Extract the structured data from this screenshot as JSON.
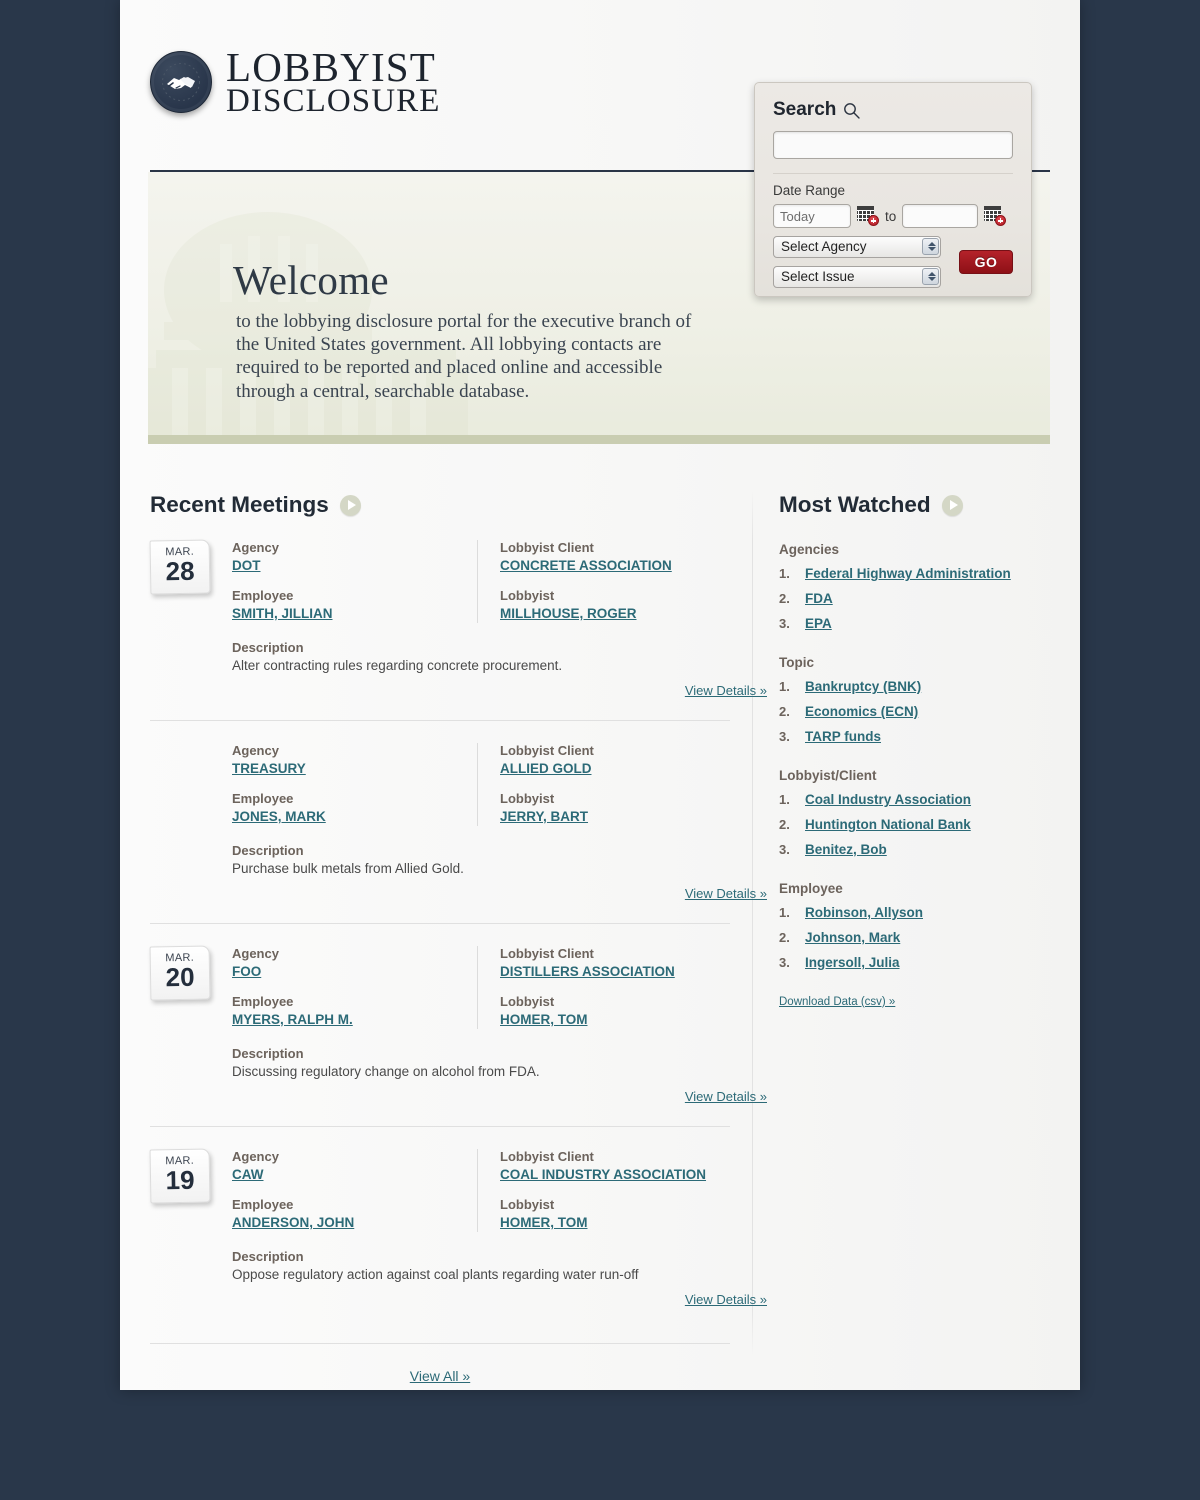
{
  "brand": {
    "line1": "LOBBYIST",
    "line2": "DISCLOSURE",
    "logo_icon": "handshake-icon"
  },
  "search": {
    "title": "Search",
    "search_icon": "search-icon",
    "query_value": "",
    "query_placeholder": "",
    "date_range_label": "Date Range",
    "date_from_value": "Today",
    "date_from_placeholder": "Today",
    "date_to_value": "",
    "date_to_placeholder": "",
    "to_label": "to",
    "calendar_icon": "calendar-add-icon",
    "agency_select": "Select Agency",
    "issue_select": "Select Issue",
    "go_label": "GO",
    "accent_red": "#9d1b22"
  },
  "banner": {
    "heading": "Welcome",
    "paragraph": "to the lobbying disclosure portal for the executive branch of the United States government. All lobbying contacts are required to be reported and placed online and accessible through a central, searchable database.",
    "watermark": "capitol-building-watermark",
    "foot_color": "#c9cdb1"
  },
  "recent_meetings": {
    "heading": "Recent Meetings",
    "arrow_icon": "play-arrow-icon",
    "labels": {
      "agency": "Agency",
      "employee": "Employee",
      "lobbyist_client": "Lobbyist Client",
      "lobbyist": "Lobbyist",
      "description": "Description",
      "view_details": "View Details »"
    },
    "view_all": "View All »",
    "items": [
      {
        "date_month": "MAR.",
        "date_day": "28",
        "has_date": true,
        "agency": "DOT",
        "employee": "SMITH, JILLIAN",
        "client": "CONCRETE ASSOCIATION",
        "lobbyist": "MILLHOUSE, ROGER",
        "description": "Alter contracting rules regarding concrete procurement."
      },
      {
        "date_month": "",
        "date_day": "",
        "has_date": false,
        "agency": "TREASURY",
        "employee": "JONES, MARK",
        "client": "ALLIED GOLD",
        "lobbyist": "JERRY, BART",
        "description": "Purchase bulk metals from Allied Gold."
      },
      {
        "date_month": "MAR.",
        "date_day": "20",
        "has_date": true,
        "agency": "FOO",
        "employee": "MYERS, RALPH M.",
        "client": "DISTILLERS ASSOCIATION",
        "lobbyist": "HOMER, TOM",
        "description": "Discussing regulatory change on alcohol from FDA."
      },
      {
        "date_month": "MAR.",
        "date_day": "19",
        "has_date": true,
        "agency": "CAW",
        "employee": "ANDERSON, JOHN",
        "client": "COAL INDUSTRY ASSOCIATION",
        "lobbyist": "HOMER, TOM",
        "description": "Oppose regulatory action against coal plants regarding water run-off"
      }
    ]
  },
  "most_watched": {
    "heading": "Most Watched",
    "arrow_icon": "play-arrow-icon",
    "download_link": "Download Data (csv) »",
    "groups": [
      {
        "title": "Agencies",
        "items": [
          {
            "num": "1.",
            "label": "Federal Highway Administration"
          },
          {
            "num": "2.",
            "label": "FDA"
          },
          {
            "num": "3.",
            "label": "EPA"
          }
        ]
      },
      {
        "title": "Topic",
        "items": [
          {
            "num": "1.",
            "label": "Bankruptcy (BNK)"
          },
          {
            "num": "2.",
            "label": "Economics (ECN)"
          },
          {
            "num": "3.",
            "label": "TARP funds"
          }
        ]
      },
      {
        "title": "Lobbyist/Client",
        "items": [
          {
            "num": "1.",
            "label": "Coal Industry Association"
          },
          {
            "num": "2.",
            "label": "Huntington National Bank"
          },
          {
            "num": "3.",
            "label": "Benitez, Bob"
          }
        ]
      },
      {
        "title": "Employee",
        "items": [
          {
            "num": "1.",
            "label": "Robinson, Allyson"
          },
          {
            "num": "2.",
            "label": "Johnson, Mark"
          },
          {
            "num": "3.",
            "label": "Ingersoll, Julia"
          }
        ]
      }
    ]
  },
  "colors": {
    "page_background": "#29374a",
    "link": "#2c6a77",
    "label": "#6c635c",
    "brand_navy": "#28354a"
  }
}
